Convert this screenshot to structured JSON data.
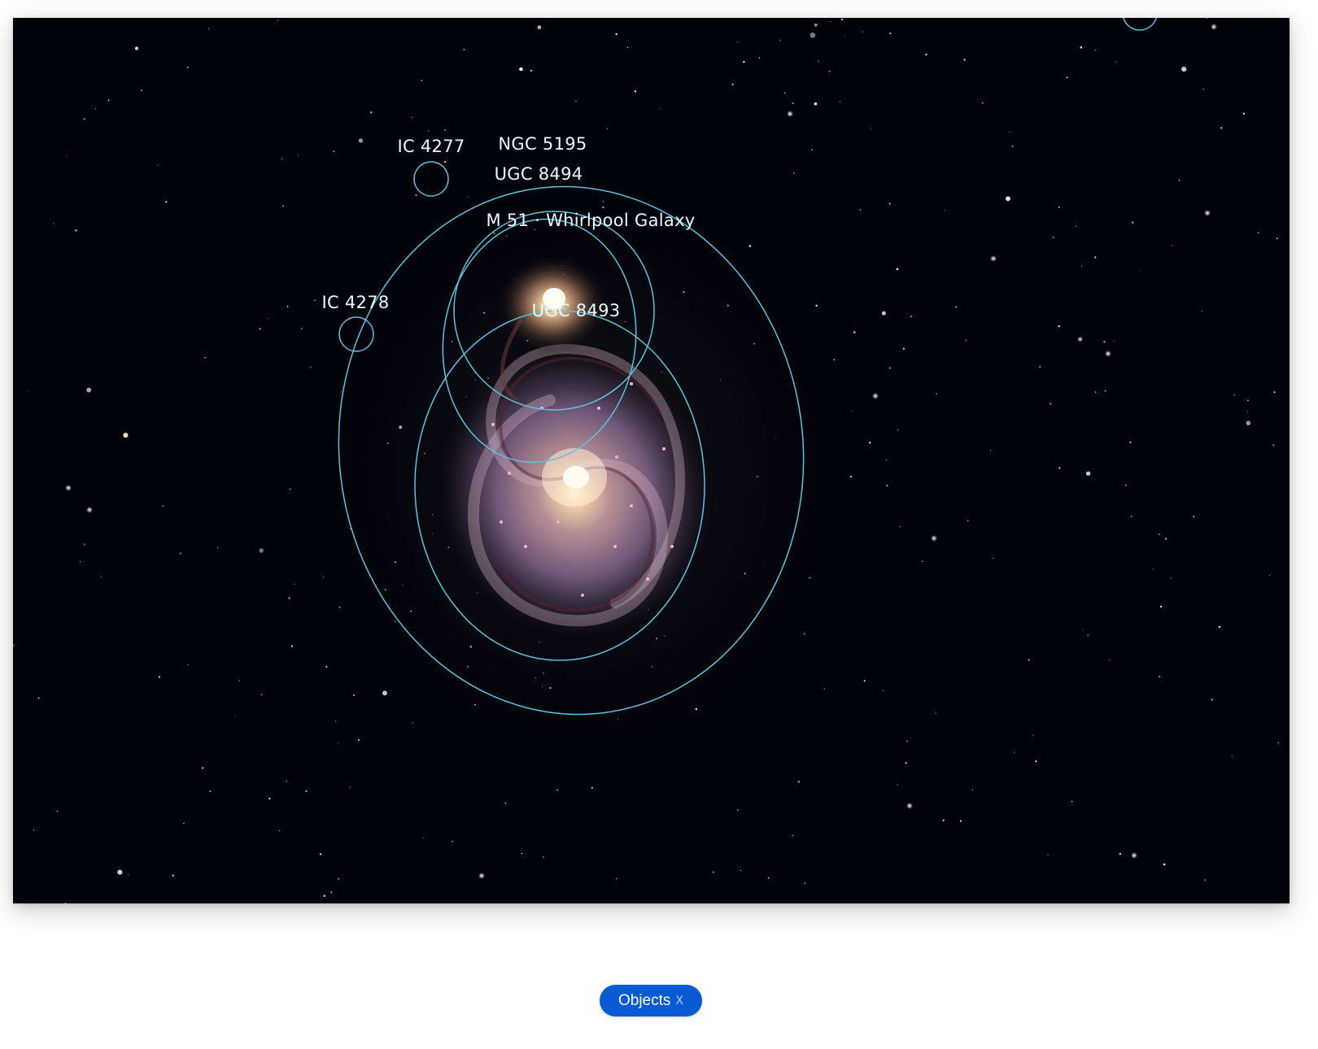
{
  "annotations": [
    {
      "id": "ic4277",
      "label": "IC 4277"
    },
    {
      "id": "ngc5195",
      "label": "NGC 5195"
    },
    {
      "id": "ugc8494",
      "label": "UGC 8494"
    },
    {
      "id": "m51",
      "label": "M 51 · Whirlpool Galaxy"
    },
    {
      "id": "ic4278",
      "label": "IC 4278"
    },
    {
      "id": "ugc8493",
      "label": "UGC 8493"
    }
  ],
  "objects_toggle": {
    "label": "Objects",
    "close_icon": "close-icon",
    "close_glyph": "X"
  },
  "colors": {
    "overlay": "#5cc3dd",
    "label": "#e8fbff",
    "toggle_bg": "#0a5bd3",
    "sky": "#00020a"
  }
}
